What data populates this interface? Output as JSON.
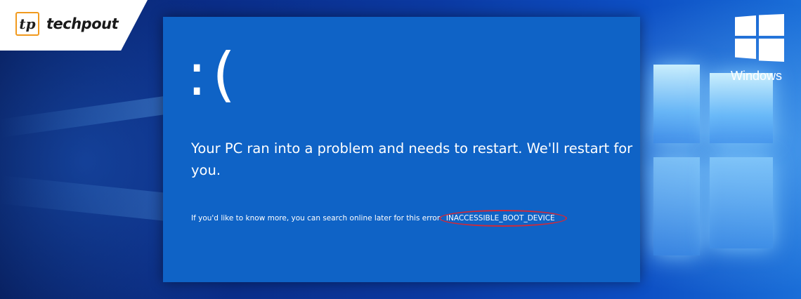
{
  "brand": {
    "logo_mark": "tp",
    "logo_text": "techpout",
    "accent_color": "#f19a1e"
  },
  "bsod": {
    "sad_face": ":(",
    "message": "Your PC ran into a problem and needs to restart. We'll restart for you.",
    "info_prefix": "If you'd like to know more, you can search online later for this error: ",
    "error_code": "INACCESSIBLE_BOOT_DEVICE",
    "background_color": "#0f63c6",
    "highlight_color": "#d02a3a"
  },
  "windows_badge": {
    "label": "Windows",
    "icon": "windows-logo-icon"
  }
}
